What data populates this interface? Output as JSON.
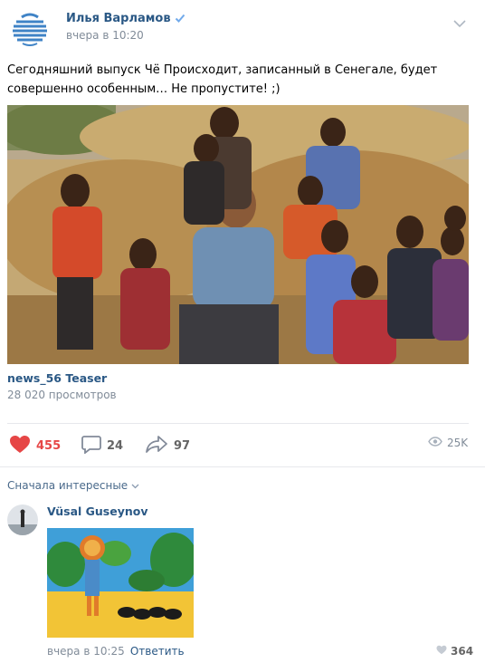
{
  "post": {
    "author": "Илья Варламов",
    "time": "вчера в 10:20",
    "text": "Сегодняшний выпуск Чё Происходит, записанный в Сенегале, будет совершенно особенным… Не пропустите! ;)"
  },
  "video": {
    "title": "news_56 Teaser",
    "views": "28 020 просмотров"
  },
  "actions": {
    "likes": "455",
    "comments": "24",
    "shares": "97",
    "views": "25K"
  },
  "comments_sort": "Сначала интересные",
  "comment": {
    "author": "Vüsal Guseynov",
    "time": "вчера в 10:25",
    "reply_label": "Ответить",
    "likes": "364"
  },
  "colors": {
    "link": "#2a5885",
    "like_red": "#e64646",
    "muted": "#818c99"
  }
}
